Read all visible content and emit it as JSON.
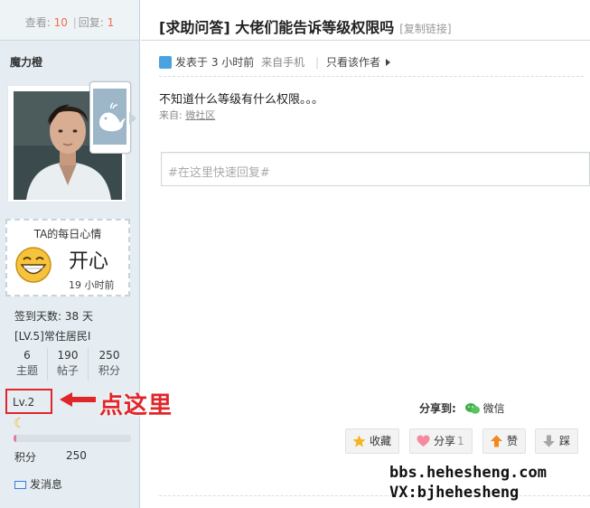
{
  "sidebar": {
    "stats": {
      "views_label": "查看:",
      "views": "10",
      "sep": "|",
      "replies_label": "回复:",
      "replies": "1"
    },
    "username": "魔力橙",
    "mood": {
      "title": "TA的每日心情",
      "text": "开心",
      "time": "19 小时前"
    },
    "signin_days": "签到天数: 38 天",
    "rank": "[LV.5]常住居民I",
    "counts": [
      {
        "value": "6",
        "label": "主题"
      },
      {
        "value": "190",
        "label": "帖子"
      },
      {
        "value": "250",
        "label": "积分"
      }
    ],
    "level": "Lv.2",
    "annotation": "点这里",
    "level_icon": "moon-icon",
    "progress_fraction": 0.02,
    "points_label": "积分",
    "points_value": "250",
    "send_message": "发消息"
  },
  "post": {
    "title": "[求助问答] 大佬们能告诉等级权限吗",
    "copy_link": "[复制链接]",
    "meta": {
      "posted": "发表于 3 小时前",
      "from": "来自手机",
      "sep": "|",
      "author_only": "只看该作者"
    },
    "content": "不知道什么等级有什么权限。。。",
    "source_prefix": "来自:",
    "source_link": "微社区",
    "reply_placeholder": "#在这里快速回复#"
  },
  "share": {
    "label": "分享到:",
    "target": "微信"
  },
  "actions": [
    {
      "label": "收藏",
      "count": "",
      "icon": "star-icon"
    },
    {
      "label": "分享",
      "count": "1",
      "icon": "heart-icon"
    },
    {
      "label": "赞",
      "count": "",
      "icon": "thumb-up-icon"
    },
    {
      "label": "踩",
      "count": "",
      "icon": "thumb-down-icon"
    }
  ],
  "watermark": {
    "line1": "bbs.hehesheng.com",
    "line2": "VX:bjhehesheng"
  },
  "colors": {
    "accent_red": "#e0262a",
    "stat_number": "#f26c4f",
    "sidebar_bg": "#e5edf2"
  }
}
